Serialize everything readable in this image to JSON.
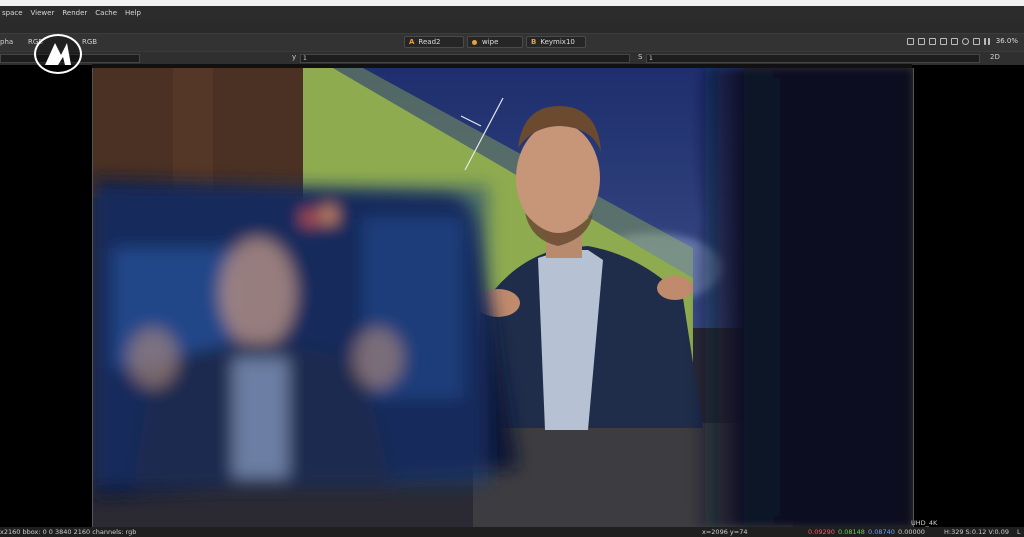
{
  "menu": {
    "items": [
      "space",
      "Viewer",
      "Render",
      "Cache",
      "Help"
    ]
  },
  "toolbar": {
    "channels_label": "pha",
    "rgb_left": "RGB",
    "rgb_right": "RGB",
    "input_a": {
      "tag": "A",
      "label": "Read2"
    },
    "wipe": {
      "label": "wipe"
    },
    "input_b": {
      "tag": "B",
      "label": "Keymix10"
    },
    "zoom": "36.0%"
  },
  "toolbar2": {
    "y_label": "y",
    "y_value": "1",
    "s_label": "S",
    "s_value": "1",
    "mode": "2D"
  },
  "status": {
    "left": "x2160  bbox: 0 0 3840 2160 channels: rgb",
    "coords": "x=2096 y=74",
    "r": "0.09290",
    "g": "0.08148",
    "b": "0.08740",
    "a": "0.00000",
    "hsv": "H:329 S:0.12 V:0.09",
    "tail": "L",
    "format": "UHD_4K"
  },
  "colors": {
    "green_screen": "#8fab4f",
    "accent_orange": "#e8a23a",
    "red": "#ff5a5a",
    "green": "#5fd35f",
    "blue": "#6aa0ff"
  }
}
